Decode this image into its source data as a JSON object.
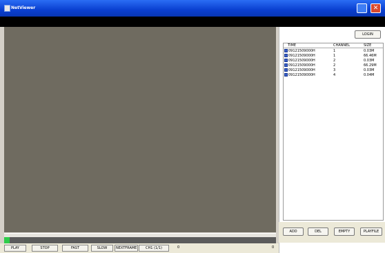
{
  "window": {
    "title": "NetViewer"
  },
  "rightpanel": {
    "top_button": "LOGIN"
  },
  "filelist": {
    "headers": [
      "TIME",
      "CHANNEL",
      "SIZE"
    ],
    "rows": [
      {
        "time": "09121509000H",
        "channel": "1",
        "size": "0.03M"
      },
      {
        "time": "09121509000H",
        "channel": "1",
        "size": "66.46M"
      },
      {
        "time": "09121509000H",
        "channel": "2",
        "size": "0.03M"
      },
      {
        "time": "09121509000H",
        "channel": "2",
        "size": "66.29M"
      },
      {
        "time": "09121509000H",
        "channel": "3",
        "size": "0.03M"
      },
      {
        "time": "09121509000H",
        "channel": "4",
        "size": "0.04M"
      }
    ]
  },
  "actions": {
    "add": "ADD",
    "del": "DEL",
    "empty": "EMPTY",
    "playfile": "PLAYFILE"
  },
  "controls": {
    "play": "PLAY",
    "stop": "STOP",
    "fast": "FAST",
    "slow": "SLOW",
    "nextframe": "NEXTFRAME",
    "ch": "CH1 (1/1)",
    "status_left": "0",
    "status_right": "0"
  }
}
